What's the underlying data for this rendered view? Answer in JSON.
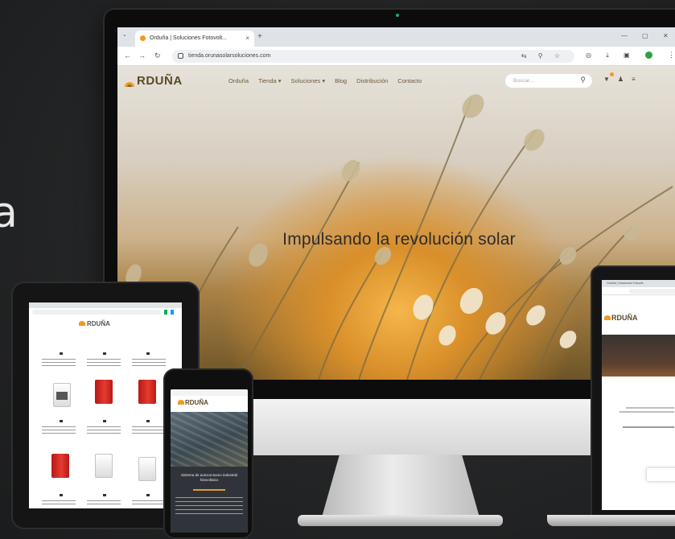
{
  "side_letter": "a",
  "desktop": {
    "tab_title": "Orduña | Soluciones Fotovolt...",
    "url": "tienda.orunasolarsoluciones.com",
    "site": {
      "logo": "RDUÑA",
      "menu": [
        "Orduña",
        "Tienda ▾",
        "Soluciones ▾",
        "Blog",
        "Distribución",
        "Contacto"
      ],
      "search_placeholder": "Buscar...",
      "hero_title": "Impulsando la revolución solar"
    }
  },
  "tablet": {
    "logo": "RDUÑA"
  },
  "phone": {
    "logo": "RDUÑA",
    "hero_title": "Sistema de autoconsumo industrial fotovoltaico"
  },
  "laptop": {
    "tab_title": "Orduña | Soluciones Fotovolt...",
    "logo": "RDUÑA"
  },
  "colors": {
    "accent": "#f29a1f",
    "background": "#262728",
    "product_red": "#e53a2f"
  },
  "icons": [
    "chevron-left-icon",
    "chevron-right-icon",
    "reload-icon",
    "lock-icon",
    "search-icon",
    "cart-icon",
    "user-icon",
    "menu-dots-icon",
    "close-icon",
    "plus-icon"
  ]
}
